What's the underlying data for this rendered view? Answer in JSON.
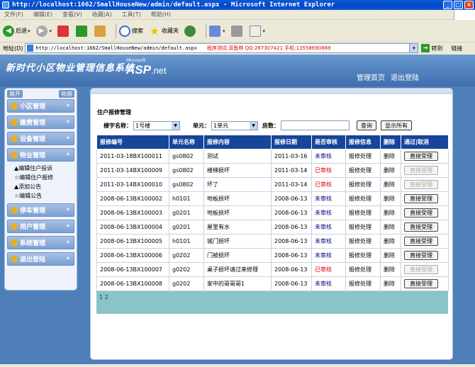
{
  "window": {
    "title": "http://localhost:1662/SmallHouseNew/admin/default.aspx - Microsoft Internet Explorer"
  },
  "menu": [
    "文件(F)",
    "编辑(E)",
    "查看(V)",
    "收藏(A)",
    "工具(T)",
    "帮助(H)"
  ],
  "toolbar": {
    "back": "后退",
    "search": "搜索",
    "favorites": "收藏夹"
  },
  "address": {
    "label": "地址(D)",
    "url": "http://localhost:1662/SmallHouseNew/admin/default.aspx",
    "ad": "程序测试:双鱼林 QQ:287307421 手机:13558690869",
    "go": "转到",
    "links": "链接"
  },
  "banner": {
    "site_title": "新时代小区物业管理信息系统",
    "logo_top": "Microsoft",
    "logo_main": "ASP",
    "logo_suffix": ".net",
    "nav": [
      "管理首页",
      "退出登陆"
    ]
  },
  "sidebar": {
    "expand": "展开",
    "collapse": "收缩",
    "items": [
      {
        "label": "小区管理",
        "icon": "building-icon"
      },
      {
        "label": "缴费管理",
        "icon": "money-icon"
      },
      {
        "label": "设备管理",
        "icon": "device-icon"
      },
      {
        "label": "物业管理",
        "icon": "property-icon"
      }
    ],
    "sub_items": [
      "▲编辑住户投诉",
      "☆编辑住户报修",
      "▲添加公告",
      "☆编辑公告"
    ],
    "items_after": [
      {
        "label": "停车管理",
        "icon": "car-icon"
      },
      {
        "label": "用户管理",
        "icon": "user-icon"
      },
      {
        "label": "系统管理",
        "icon": "system-icon"
      },
      {
        "label": "退出登陆",
        "icon": "logout-icon"
      }
    ]
  },
  "content": {
    "title": "住户报修管理",
    "search": {
      "building_label": "楼宇名称：",
      "building_value": "1号楼",
      "unit_label": "单元：",
      "unit_value": "1单元",
      "floor_label": "房数：",
      "query_btn": "查询",
      "show_all_btn": "显示所有"
    },
    "table": {
      "headers": [
        "报修编号",
        "单元名称",
        "报修内容",
        "报修日期",
        "是否审核",
        "报修信息",
        "删除",
        "通过|取消"
      ],
      "rows": [
        {
          "id": "2011-03-18BX100011",
          "unit": "gs0802",
          "content": "测试",
          "date": "2011-03-16",
          "status": "未审核",
          "info": "报修处理",
          "del": "删除",
          "action": "直接受理",
          "reviewed": false
        },
        {
          "id": "2011-03-14BX100009",
          "unit": "gs0802",
          "content": "楼梯损坏",
          "date": "2011-03-14",
          "status": "已审核",
          "info": "报修处理",
          "del": "删除",
          "action": "直接受理",
          "reviewed": true
        },
        {
          "id": "2011-03-14BX100010",
          "unit": "gs0802",
          "content": "坏了",
          "date": "2011-03-14",
          "status": "已审核",
          "info": "报修处理",
          "del": "删除",
          "action": "直接受理",
          "reviewed": true
        },
        {
          "id": "2008-06-13BX100002",
          "unit": "h0101",
          "content": "地板损坏",
          "date": "2008-06-13",
          "status": "未审核",
          "info": "报修处理",
          "del": "删除",
          "action": "直接受理",
          "reviewed": false
        },
        {
          "id": "2008-06-13BX100003",
          "unit": "g0201",
          "content": "地板损坏",
          "date": "2008-06-13",
          "status": "未审核",
          "info": "报修处理",
          "del": "删除",
          "action": "直接受理",
          "reviewed": false
        },
        {
          "id": "2008-06-13BX100004",
          "unit": "g0201",
          "content": "屋里有水",
          "date": "2008-06-13",
          "status": "未审核",
          "info": "报修处理",
          "del": "删除",
          "action": "直接受理",
          "reviewed": false
        },
        {
          "id": "2008-06-13BX100005",
          "unit": "h0101",
          "content": "城门损坏",
          "date": "2008-06-13",
          "status": "未审核",
          "info": "报修处理",
          "del": "删除",
          "action": "直接受理",
          "reviewed": false
        },
        {
          "id": "2008-06-13BX100006",
          "unit": "g0202",
          "content": "门被损坏",
          "date": "2008-06-13",
          "status": "未审核",
          "info": "报修处理",
          "del": "删除",
          "action": "直接受理",
          "reviewed": false
        },
        {
          "id": "2008-06-13BX100007",
          "unit": "g0202",
          "content": "桌子损坏请过来修理",
          "date": "2008-06-13",
          "status": "已审核",
          "info": "报修处理",
          "del": "删除",
          "action": "直接受理",
          "reviewed": true
        },
        {
          "id": "2008-06-13BX100008",
          "unit": "g0202",
          "content": "家中的哥哥哥1",
          "date": "2008-06-13",
          "status": "未审核",
          "info": "报修处理",
          "del": "删除",
          "action": "直接受理",
          "reviewed": false
        }
      ]
    },
    "pager": "1 2"
  },
  "colors": {
    "table_header": "#16459a",
    "banner": "#4a7ab8",
    "unreviewed": "#000080",
    "reviewed": "#dd0000",
    "pager_bg": "#8ac4c4"
  }
}
